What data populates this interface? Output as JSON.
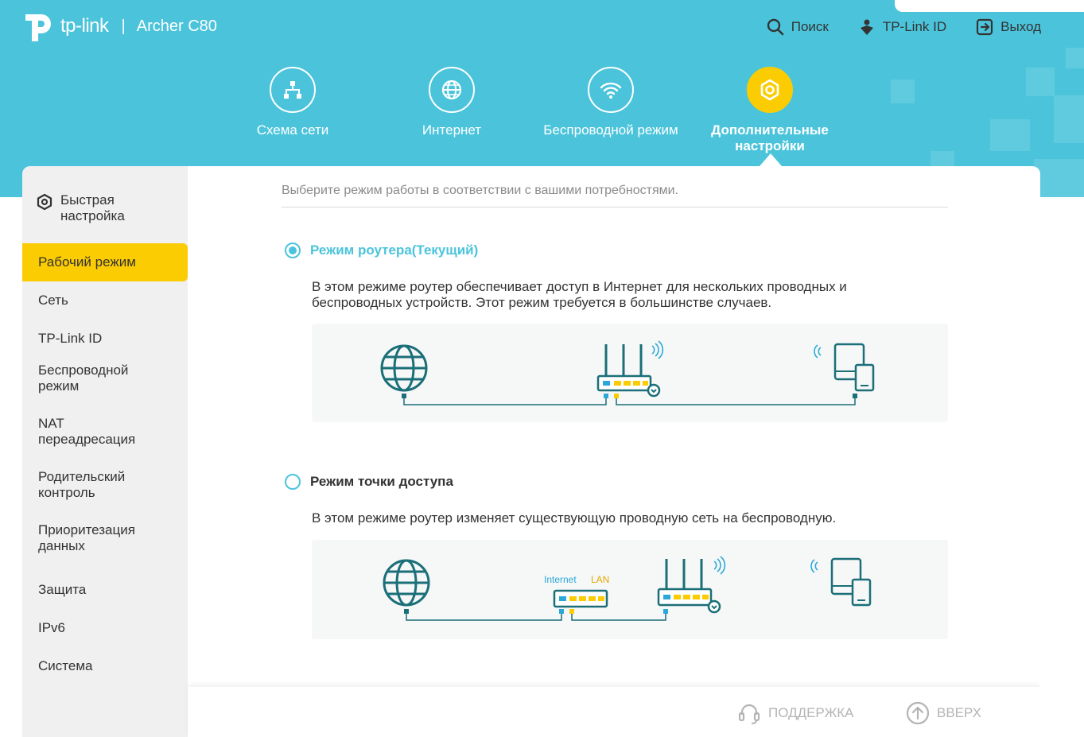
{
  "header": {
    "brand": "tp-link",
    "separator": "|",
    "model": "Archer C80",
    "actions": [
      {
        "label": "Поиск",
        "icon": "search-icon"
      },
      {
        "label": "TP-Link ID",
        "icon": "tplink-id-icon"
      },
      {
        "label": "Выход",
        "icon": "logout-icon"
      }
    ]
  },
  "nav": [
    {
      "label": "Схема сети",
      "icon": "network-map-icon",
      "active": false
    },
    {
      "label": "Интернет",
      "icon": "globe-icon",
      "active": false
    },
    {
      "label": "Беспроводной режим",
      "icon": "wifi-icon",
      "active": false
    },
    {
      "label": "Дополнительные настройки",
      "icon": "gear-icon",
      "active": true
    }
  ],
  "sidebar": {
    "items": [
      {
        "label": "Быстрая настройка"
      },
      {
        "label": "Рабочий режим"
      },
      {
        "label": "Сеть"
      },
      {
        "label": "TP-Link ID"
      },
      {
        "label": "Беспроводной режим"
      },
      {
        "label": "NAT переадресация"
      },
      {
        "label": "Родительский контроль"
      },
      {
        "label": "Приоритезация данных"
      },
      {
        "label": "Защита"
      },
      {
        "label": "IPv6"
      },
      {
        "label": "Система"
      }
    ],
    "active_index": 1
  },
  "content": {
    "hint": "Выберите режим работы в соответствии с вашими потребностями.",
    "modes": [
      {
        "title": "Режим роутера(Текущий)",
        "selected": true,
        "description": "В этом режиме роутер обеспечивает доступ в Интернет для нескольких проводных и беспроводных устройств. Этот режим требуется в большинстве случаев."
      },
      {
        "title": "Режим точки доступа",
        "selected": false,
        "description": "В этом режиме роутер изменяет существующую проводную сеть на беспроводную.",
        "diagram_labels": {
          "internet": "Internet",
          "lan": "LAN"
        }
      }
    ]
  },
  "footer": {
    "support": "ПОДДЕРЖКА",
    "top": "ВВЕРХ"
  },
  "colors": {
    "brand": "#4bc4db",
    "accent": "#fccc02",
    "diagram_teal": "#1a6f78",
    "port_blue": "#2aa9d8",
    "port_yellow": "#fccc02"
  }
}
